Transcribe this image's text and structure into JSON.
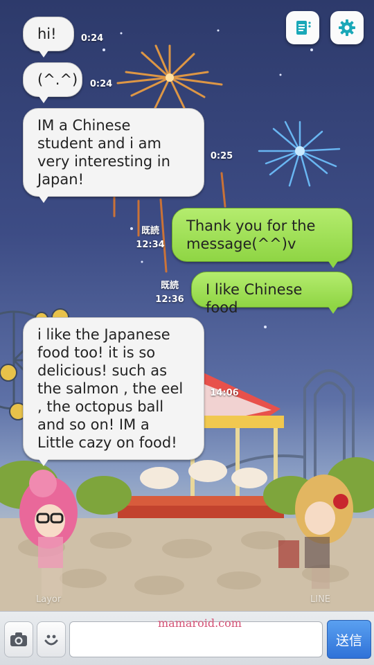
{
  "messages": [
    {
      "text": "hi!",
      "time": "0:24"
    },
    {
      "text": "(^.^)",
      "time": "0:24"
    },
    {
      "text": "IM a Chinese student and i am very interesting in Japan!",
      "time": "0:25"
    },
    {
      "text": "Thank you for the message(^^)v",
      "read": "既読",
      "time": "12:34"
    },
    {
      "text": "I like Chinese food",
      "read": "既読",
      "time": "12:36"
    },
    {
      "text": "i like the Japanese food too! it is so delicious! such as the salmon , the eel , the octopus ball and so on! IM a Little cazy on food!",
      "time": "14:06"
    }
  ],
  "avatars": {
    "left_name": "Layor",
    "right_name": "LINE"
  },
  "toolbar": {
    "notes_icon": "notes-icon",
    "settings_icon": "gear-icon"
  },
  "input_bar": {
    "camera_icon": "camera-icon",
    "emoji_icon": "smiley-icon",
    "text_value": "",
    "send_label": "送信"
  },
  "watermark": "mamaroid.com",
  "colors": {
    "outgoing_bubble": "#9ee05a",
    "incoming_bubble": "#f4f4f4",
    "send_button": "#3b80e0",
    "accent_icon": "#1aa8b8"
  }
}
